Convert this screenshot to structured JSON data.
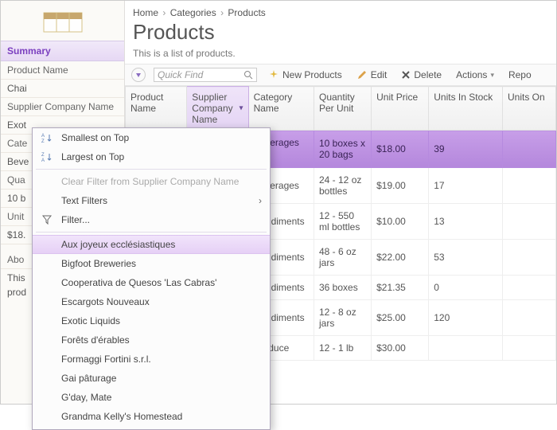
{
  "breadcrumb": {
    "home": "Home",
    "categories": "Categories",
    "products": "Products"
  },
  "heading": "Products",
  "subtitle": "This is a list of products.",
  "search": {
    "placeholder": "Quick Find"
  },
  "toolbar": {
    "new": "New Products",
    "edit": "Edit",
    "delete": "Delete",
    "actions": "Actions",
    "report": "Repo"
  },
  "cols": {
    "product": "Product Name",
    "supplier": "Supplier Company Name",
    "category": "Category Name",
    "qty": "Quantity Per Unit",
    "price": "Unit Price",
    "stock": "Units In Stock",
    "order": "Units On"
  },
  "rows": [
    {
      "category": "Beverages",
      "qty": "10 boxes x 20 bags",
      "price": "$18.00",
      "stock": "39"
    },
    {
      "category": "Beverages",
      "qty": "24 - 12 oz bottles",
      "price": "$19.00",
      "stock": "17"
    },
    {
      "category": "Condiments",
      "qty": "12 - 550 ml bottles",
      "price": "$10.00",
      "stock": "13"
    },
    {
      "category": "Condiments",
      "qty": "48 - 6 oz jars",
      "price": "$22.00",
      "stock": "53"
    },
    {
      "category": "Condiments",
      "qty": "36 boxes",
      "price": "$21.35",
      "stock": "0"
    },
    {
      "category": "Condiments",
      "qty": "12 - 8 oz jars",
      "price": "$25.00",
      "stock": "120"
    },
    {
      "category": "Produce",
      "qty": "12 - 1 lb",
      "price": "$30.00",
      "stock": ""
    }
  ],
  "sidebar": {
    "summary": "Summary",
    "fields": {
      "product_name": "Product Name",
      "chai": "Chai",
      "supplier": "Supplier Company Name",
      "exot": "Exot",
      "cate": "Cate",
      "beve": "Beve",
      "qty": "Qua",
      "tenb": "10 b",
      "unit": "Unit",
      "price": "$18.",
      "abo": "Abo",
      "this": "This",
      "prod": "prod"
    }
  },
  "menu": {
    "smallest": "Smallest on Top",
    "largest": "Largest on Top",
    "clear": "Clear Filter from Supplier Company Name",
    "textfilters": "Text Filters",
    "filter": "Filter...",
    "items": [
      "Aux joyeux ecclésiastiques",
      "Bigfoot Breweries",
      "Cooperativa de Quesos 'Las Cabras'",
      "Escargots Nouveaux",
      "Exotic Liquids",
      "Forêts d'érables",
      "Formaggi Fortini s.r.l.",
      "Gai pâturage",
      "G'day, Mate",
      "Grandma Kelly's Homestead"
    ]
  }
}
